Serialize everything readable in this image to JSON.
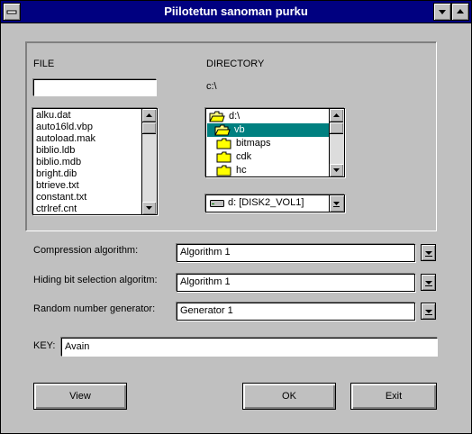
{
  "window": {
    "title": "Piilotetun sanoman purku"
  },
  "file": {
    "label": "FILE",
    "name_value": "",
    "items": [
      "alku.dat",
      "auto16ld.vbp",
      "autoload.mak",
      "biblio.ldb",
      "biblio.mdb",
      "bright.dib",
      "btrieve.txt",
      "constant.txt",
      "ctrlref.cnt"
    ]
  },
  "directory": {
    "label": "DIRECTORY",
    "current_path": "c:\\",
    "items": [
      {
        "label": "d:\\",
        "state": "open"
      },
      {
        "label": "vb",
        "state": "open-selected"
      },
      {
        "label": "bitmaps",
        "state": "closed"
      },
      {
        "label": "cdk",
        "state": "closed"
      },
      {
        "label": "hc",
        "state": "closed"
      }
    ],
    "drive": "d: [DISK2_VOL1]"
  },
  "options": {
    "compression_label": "Compression algorithm:",
    "compression_value": "Algorithm 1",
    "hiding_label": "Hiding bit selection algoritm:",
    "hiding_value": "Algorithm 1",
    "random_label": "Random number generator:",
    "random_value": "Generator 1"
  },
  "key": {
    "label": "KEY:",
    "value": "Avain"
  },
  "buttons": {
    "view": "View",
    "ok": "OK",
    "exit": "Exit"
  },
  "colors": {
    "titlebar": "#000080",
    "selection": "#008080",
    "face": "#c0c0c0"
  }
}
